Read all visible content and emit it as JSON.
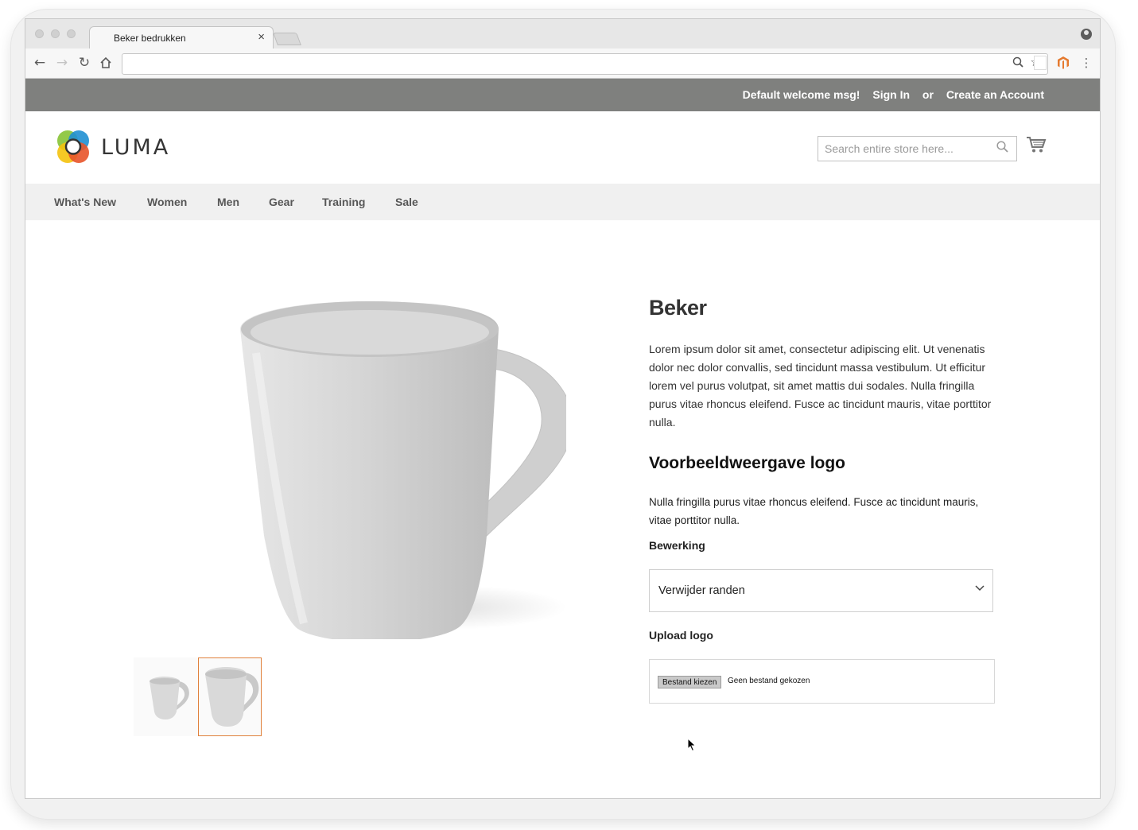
{
  "browser": {
    "tab_title": "Beker bedrukken",
    "tab_close": "×",
    "url": ""
  },
  "panel": {
    "welcome": "Default welcome msg!",
    "sign_in": "Sign In",
    "or": "or",
    "create_account": "Create an Account"
  },
  "header": {
    "logo_text": "LUMA",
    "search_placeholder": "Search entire store here..."
  },
  "nav": {
    "items": [
      "What's New",
      "Women",
      "Men",
      "Gear",
      "Training",
      "Sale"
    ]
  },
  "product": {
    "title": "Beker",
    "description": "Lorem ipsum dolor sit amet, consectetur adipiscing elit. Ut venenatis dolor nec dolor convallis, sed tincidunt massa vestibulum. Ut efficitur lorem vel purus volutpat, sit amet mattis dui sodales. Nulla fringilla purus vitae rhoncus eleifend. Fusce ac tincidunt mauris, vitae porttitor nulla.",
    "section_title": "Voorbeeldweergave logo",
    "section_text": "Nulla fringilla purus vitae rhoncus eleifend. Fusce ac tincidunt mauris, vitae porttitor nulla.",
    "bewerking_label": "Bewerking",
    "bewerking_value": "Verwijder randen",
    "upload_label": "Upload logo",
    "file_button": "Bestand kiezen",
    "file_status": "Geen bestand gekozen"
  },
  "colors": {
    "panel_bg": "#7f807e",
    "nav_bg": "#f0f0f0",
    "active_thumb_border": "#e0803b"
  }
}
